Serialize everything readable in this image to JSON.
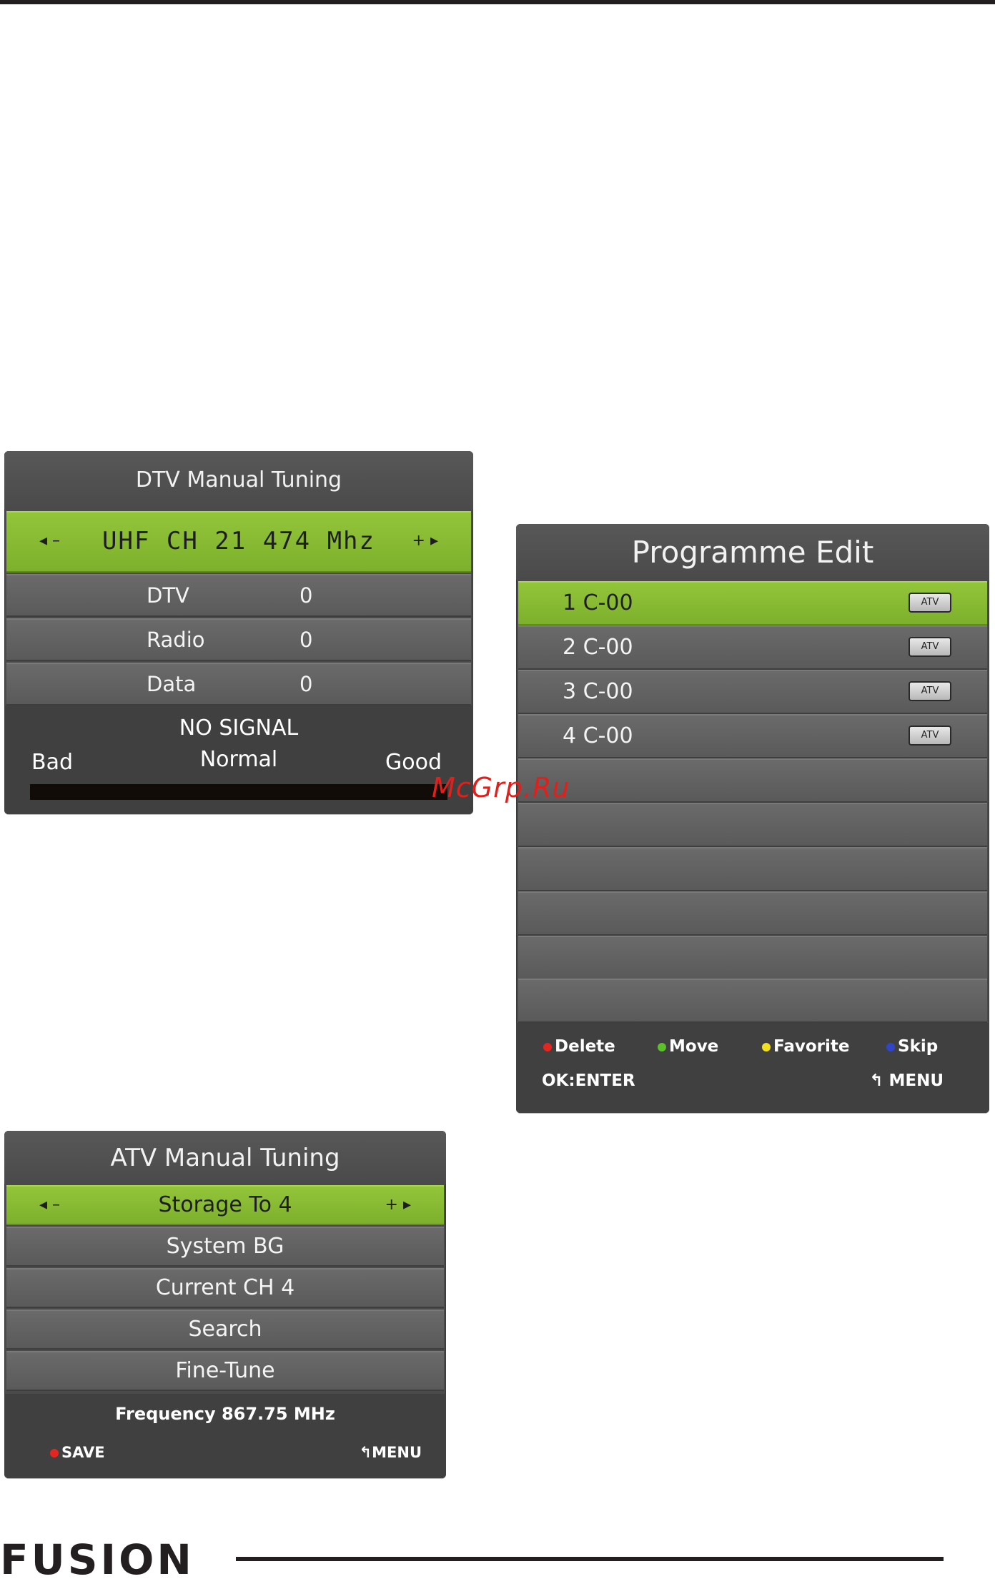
{
  "dtv": {
    "title": "DTV Manual Tuning",
    "left_arrows": "◂ –",
    "frequency": "UHF CH 21 474  Mhz",
    "right_arrows": "+ ▸",
    "counts": [
      {
        "label": "DTV",
        "value": "0"
      },
      {
        "label": "Radio",
        "value": "0"
      },
      {
        "label": "Data",
        "value": "0"
      }
    ],
    "signal_status": "NO SIGNAL",
    "signal_bad": "Bad",
    "signal_normal": "Normal",
    "signal_good": "Good"
  },
  "programme_edit": {
    "title": "Programme Edit",
    "rows": [
      {
        "label": "1  C-00",
        "badge": "ATV"
      },
      {
        "label": "2  C-00",
        "badge": "ATV"
      },
      {
        "label": "3  C-00",
        "badge": "ATV"
      },
      {
        "label": "4  C-00",
        "badge": "ATV"
      }
    ],
    "legend": [
      {
        "label": "Delete",
        "color": "#e3261f"
      },
      {
        "label": "Move",
        "color": "#5cc02a"
      },
      {
        "label": "Favorite",
        "color": "#f0e020"
      },
      {
        "label": "Skip",
        "color": "#3045c8"
      }
    ],
    "ok_label": "OK:ENTER",
    "menu_label": "↰ MENU"
  },
  "atv": {
    "title": "ATV Manual Tuning",
    "left_arrows": "◂ –",
    "right_arrows": "+ ▸",
    "rows": [
      "Storage To 4",
      "System BG",
      "Current CH 4",
      "Search",
      "Fine-Tune"
    ],
    "frequency": "Frequency 867.75 MHz",
    "save_label": "SAVE",
    "menu_label": "↰MENU"
  },
  "watermark": "McGrp.Ru",
  "brand": "FUSION"
}
